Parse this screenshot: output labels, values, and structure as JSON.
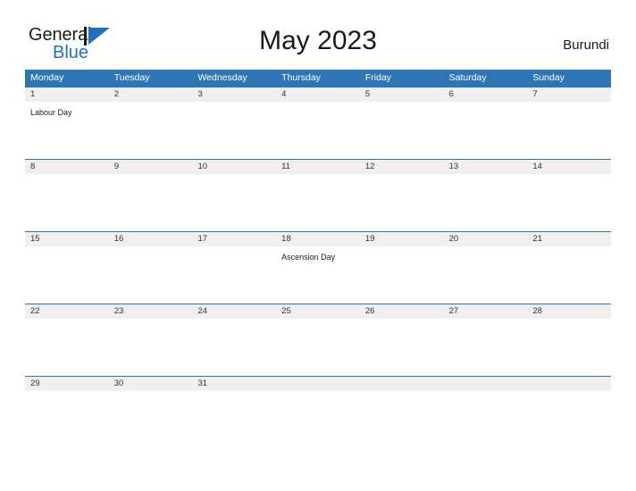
{
  "brand": {
    "name_part1": "General",
    "name_part2": "Blue",
    "flag_icon": "flag-triangle-icon",
    "accent_color": "#1f6fc0"
  },
  "header": {
    "title": "May 2023",
    "region": "Burundi"
  },
  "theme": {
    "header_blue": "#2e75b6",
    "date_band_gray": "#efefef",
    "rule_blue": "#2e75b6",
    "page_background": "#ffffff",
    "text_color": "#1a1a1a"
  },
  "calendar": {
    "month": "May",
    "year": "2023",
    "weekday_headers": [
      "Monday",
      "Tuesday",
      "Wednesday",
      "Thursday",
      "Friday",
      "Saturday",
      "Sunday"
    ],
    "weeks": [
      {
        "dates": [
          "1",
          "2",
          "3",
          "4",
          "5",
          "6",
          "7"
        ],
        "events": [
          "Labour Day",
          "",
          "",
          "",
          "",
          "",
          ""
        ]
      },
      {
        "dates": [
          "8",
          "9",
          "10",
          "11",
          "12",
          "13",
          "14"
        ],
        "events": [
          "",
          "",
          "",
          "",
          "",
          "",
          ""
        ]
      },
      {
        "dates": [
          "15",
          "16",
          "17",
          "18",
          "19",
          "20",
          "21"
        ],
        "events": [
          "",
          "",
          "",
          "Ascension Day",
          "",
          "",
          ""
        ]
      },
      {
        "dates": [
          "22",
          "23",
          "24",
          "25",
          "26",
          "27",
          "28"
        ],
        "events": [
          "",
          "",
          "",
          "",
          "",
          "",
          ""
        ]
      },
      {
        "dates": [
          "29",
          "30",
          "31",
          "",
          "",
          "",
          ""
        ],
        "events": [
          "",
          "",
          "",
          "",
          "",
          "",
          ""
        ]
      }
    ]
  }
}
